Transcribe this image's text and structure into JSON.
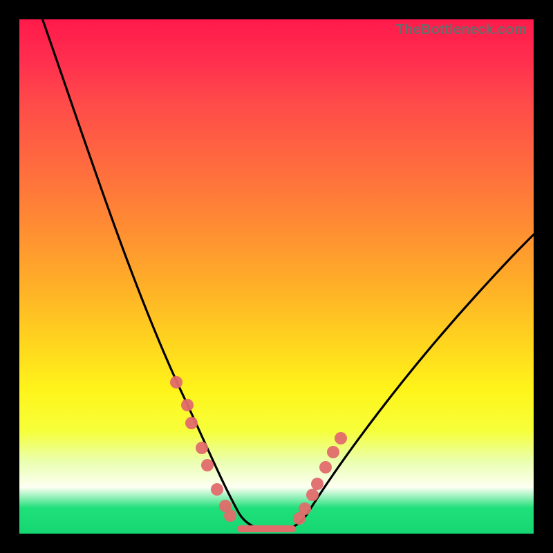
{
  "watermark": "TheBottleneck.com",
  "colors": {
    "background": "#000000",
    "curve": "#000000",
    "marker": "#e26b6b",
    "gradient_top": "#ff1a4b",
    "gradient_bottom": "#16d672"
  },
  "chart_data": {
    "type": "line",
    "title": "",
    "xlabel": "",
    "ylabel": "",
    "xlim": [
      0,
      100
    ],
    "ylim": [
      0,
      100
    ],
    "legend": false,
    "grid": false,
    "annotations": [
      "TheBottleneck.com"
    ],
    "series": [
      {
        "name": "bottleneck-curve",
        "x": [
          4,
          8,
          12,
          16,
          20,
          24,
          28,
          30,
          32,
          34,
          36,
          38,
          40,
          42,
          44,
          46,
          48,
          50,
          52,
          54,
          58,
          62,
          66,
          70,
          74,
          78,
          82,
          86,
          90,
          94,
          98
        ],
        "y": [
          100,
          92,
          83,
          74,
          66,
          57,
          48,
          44,
          39,
          34,
          29,
          24,
          18,
          12,
          6,
          2,
          0,
          0,
          0,
          2,
          6,
          12,
          18,
          23,
          28,
          33,
          38,
          42,
          46,
          50,
          54
        ]
      }
    ],
    "markers": {
      "name": "highlight-points",
      "x": [
        30.5,
        32.7,
        33.5,
        35.5,
        36.5,
        38.5,
        40.0,
        41.0,
        54.5,
        55.5,
        57.0,
        58.0,
        59.5,
        61.0,
        62.5
      ],
      "y": [
        42,
        38,
        34,
        28,
        24,
        17,
        11,
        8,
        4,
        8,
        12,
        15,
        20,
        23,
        27
      ]
    },
    "baseline": {
      "x_start": 43,
      "x_end": 53,
      "y": 0.5
    }
  }
}
